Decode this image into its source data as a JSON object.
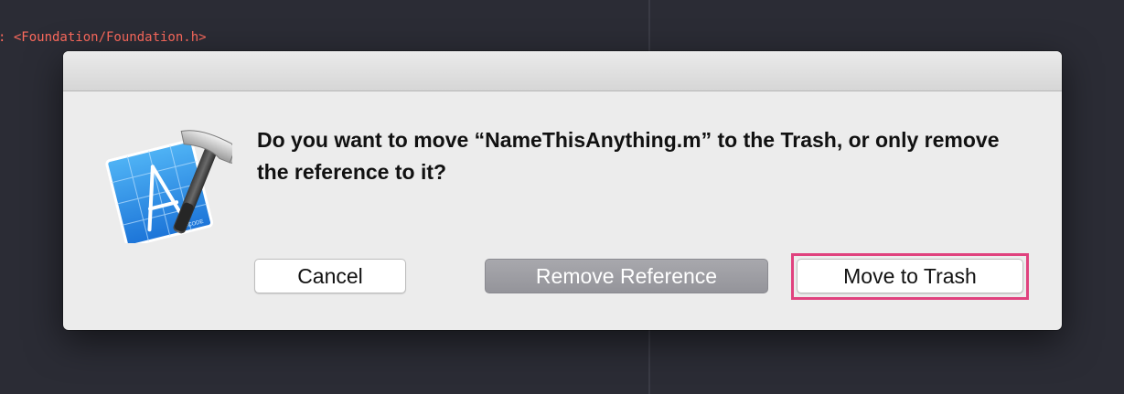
{
  "editor": {
    "code_line": ": <Foundation/Foundation.h>"
  },
  "dialog": {
    "icon": "xcode-app-icon",
    "message": "Do you want to move “NameThisAnything.m” to the Trash, or only remove the reference to it?",
    "buttons": {
      "cancel": "Cancel",
      "remove_reference": "Remove Reference",
      "move_to_trash": "Move to Trash"
    },
    "highlight_color": "#e0427e"
  },
  "colors": {
    "editor_background": "#2b2c35",
    "code_text": "#fc6a5d",
    "dialog_background": "#ececec",
    "disabled_button": "#9e9ea3"
  }
}
